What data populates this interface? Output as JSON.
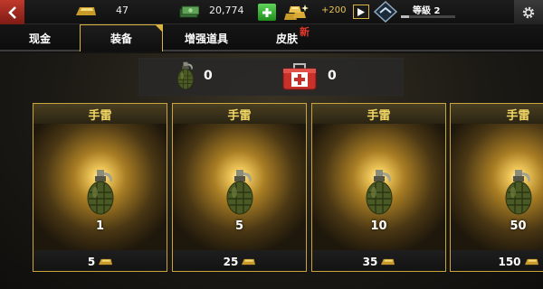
{
  "topbar": {
    "gold_amount": "47",
    "cash_amount": "20,774",
    "bonus_gold": "+200",
    "level_label": "等級 2",
    "level_progress": 0.15
  },
  "tabs": [
    {
      "label": "现金"
    },
    {
      "label": "装备"
    },
    {
      "label": "增强道具"
    },
    {
      "label": "皮肤"
    }
  ],
  "new_tag": "新",
  "inventory": {
    "grenade_count": "0",
    "medkit_count": "0"
  },
  "cards": [
    {
      "title": "手雷",
      "quantity": "1",
      "price": "5"
    },
    {
      "title": "手雷",
      "quantity": "5",
      "price": "25"
    },
    {
      "title": "手雷",
      "quantity": "10",
      "price": "35"
    },
    {
      "title": "手雷",
      "quantity": "50",
      "price": "150"
    }
  ],
  "icons": {
    "back": "chevron-left-icon",
    "settings": "gear-icon",
    "gold": "gold-bar-icon",
    "cash": "cash-stack-icon",
    "plus": "plus-icon",
    "gold_pile": "gold-pile-icon",
    "play": "play-icon",
    "rank": "rank-badge-icon",
    "grenade": "grenade-icon",
    "medkit": "medkit-icon"
  },
  "colors": {
    "accent_gold": "#d9b540",
    "back_red": "#c0392b",
    "plus_green": "#3fb23a",
    "new_red": "#e8392b"
  }
}
